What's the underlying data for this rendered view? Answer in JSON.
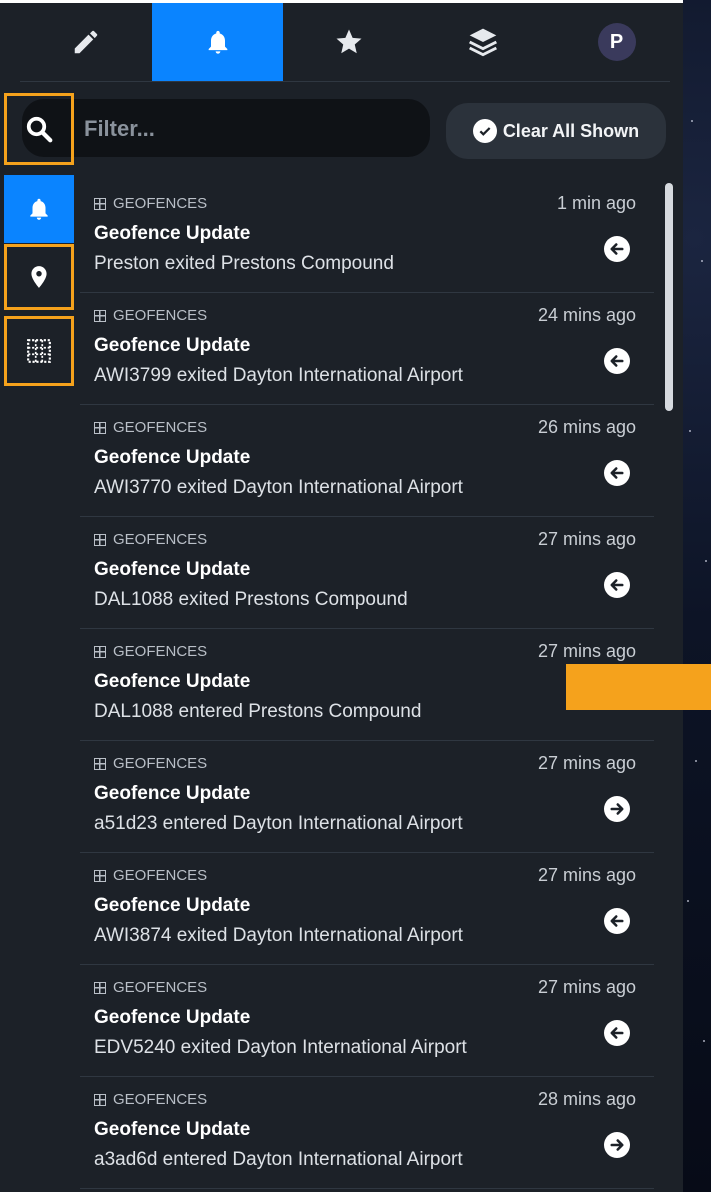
{
  "colors": {
    "accent": "#0a84ff",
    "highlight": "#f5a21c",
    "panel": "#1c2128"
  },
  "top_tabs": [
    {
      "icon": "pencil-icon"
    },
    {
      "icon": "bell-icon",
      "active": true
    },
    {
      "icon": "star-icon"
    },
    {
      "icon": "layers-icon"
    },
    {
      "icon": "avatar",
      "initial": "P"
    }
  ],
  "filter": {
    "placeholder": "Filter...",
    "value": ""
  },
  "clear_button": {
    "label": "Clear All Shown"
  },
  "side_nav": [
    {
      "icon": "search-icon"
    },
    {
      "icon": "bell-icon",
      "active": true
    },
    {
      "icon": "map-pin-icon"
    },
    {
      "icon": "grid-icon"
    }
  ],
  "notifications": [
    {
      "category": "GEOFENCES",
      "time": "1 min ago",
      "title": "Geofence Update",
      "desc": "Preston exited Prestons Compound",
      "direction": "exit"
    },
    {
      "category": "GEOFENCES",
      "time": "24 mins ago",
      "title": "Geofence Update",
      "desc": "AWI3799 exited Dayton International Airport",
      "direction": "exit"
    },
    {
      "category": "GEOFENCES",
      "time": "26 mins ago",
      "title": "Geofence Update",
      "desc": "AWI3770 exited Dayton International Airport",
      "direction": "exit"
    },
    {
      "category": "GEOFENCES",
      "time": "27 mins ago",
      "title": "Geofence Update",
      "desc": "DAL1088 exited Prestons Compound",
      "direction": "exit"
    },
    {
      "category": "GEOFENCES",
      "time": "27 mins ago",
      "title": "Geofence Update",
      "desc": "DAL1088 entered Prestons Compound",
      "direction": "enter"
    },
    {
      "category": "GEOFENCES",
      "time": "27 mins ago",
      "title": "Geofence Update",
      "desc": "a51d23 entered Dayton International Airport",
      "direction": "enter"
    },
    {
      "category": "GEOFENCES",
      "time": "27 mins ago",
      "title": "Geofence Update",
      "desc": "AWI3874 exited Dayton International Airport",
      "direction": "exit"
    },
    {
      "category": "GEOFENCES",
      "time": "27 mins ago",
      "title": "Geofence Update",
      "desc": "EDV5240 exited Dayton International Airport",
      "direction": "exit"
    },
    {
      "category": "GEOFENCES",
      "time": "28 mins ago",
      "title": "Geofence Update",
      "desc": "a3ad6d entered Dayton International Airport",
      "direction": "enter"
    }
  ]
}
